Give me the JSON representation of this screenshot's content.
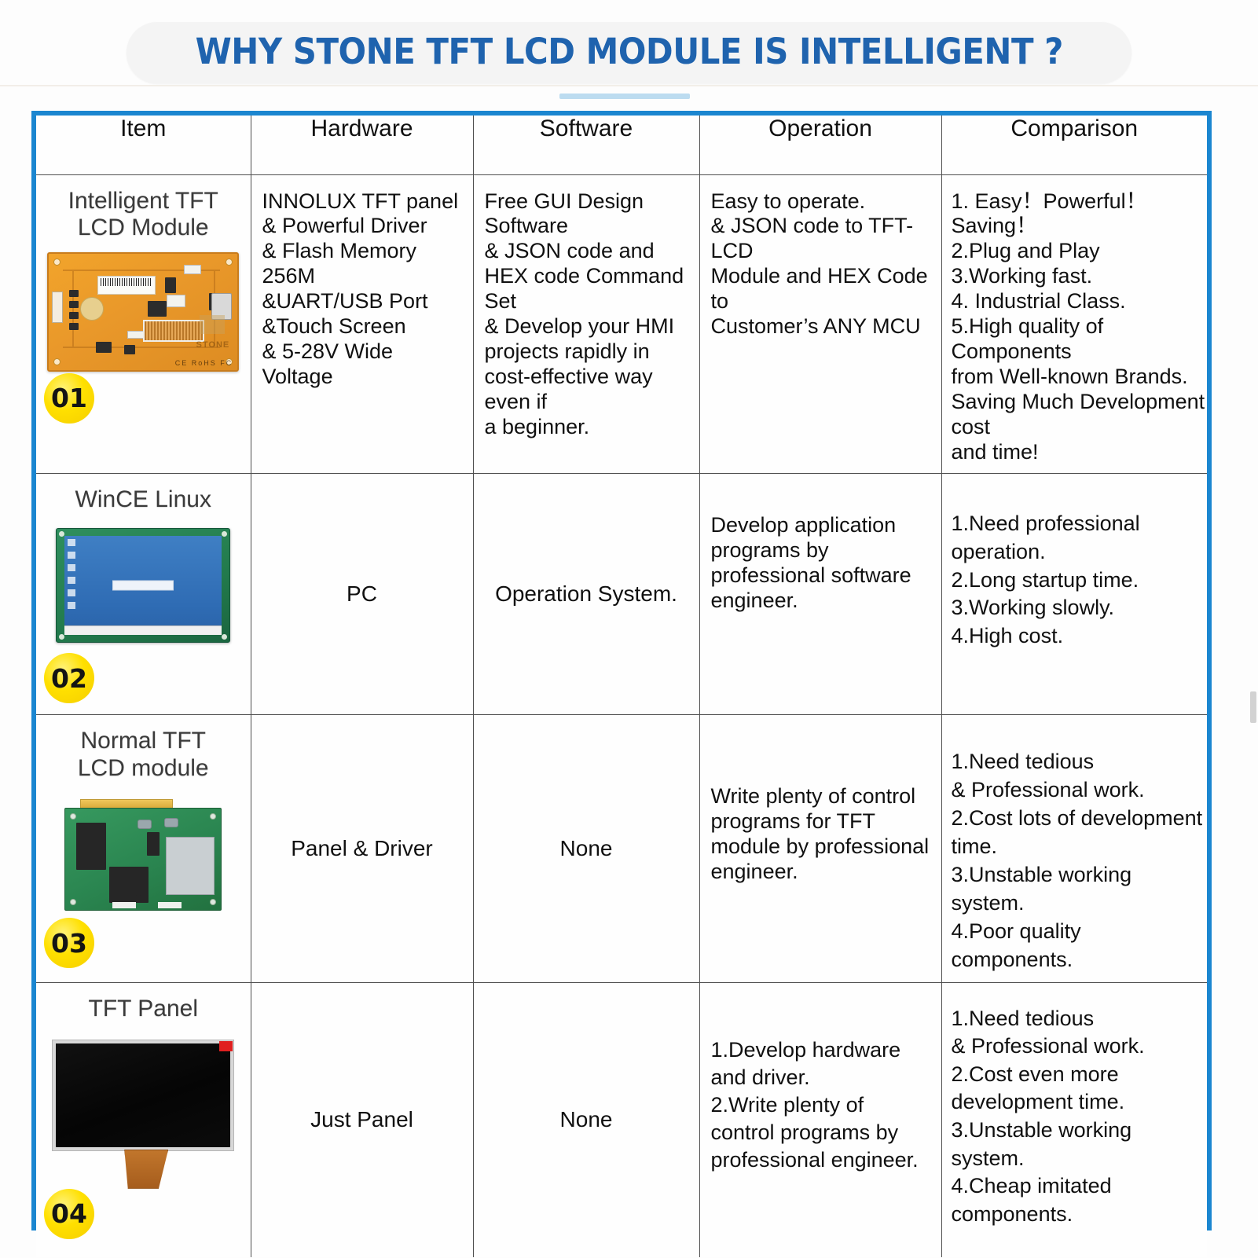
{
  "title": "WHY STONE TFT LCD MODULE IS INTELLIGENT ?",
  "colors": {
    "title_blue": "#1f63ae",
    "frame_blue": "#1b86d0",
    "accent_light_blue": "#bcdcf0",
    "badge_yellow": "#ffe000"
  },
  "table": {
    "headers": [
      "Item",
      "Hardware",
      "Software",
      "Operation",
      "Comparison"
    ],
    "rows": [
      {
        "badge": "01",
        "item_label": "Intelligent TFT\nLCD Module",
        "item_art": "orange-tft-pcb-image",
        "hardware": "INNOLUX TFT panel\n& Powerful Driver\n& Flash Memory 256M\n&UART/USB Port\n&Touch Screen\n& 5-28V Wide Voltage",
        "software": "Free GUI Design Software\n& JSON code and\nHEX code Command Set\n& Develop your HMI\nprojects rapidly in\ncost-effective way even if\na beginner.",
        "operation": "Easy to operate.\n& JSON code to TFT-LCD\nModule and HEX Code to\nCustomer’s  ANY MCU",
        "comparison": "1. Easy！Powerful！Saving！\n2.Plug and Play\n3.Working fast.\n4. Industrial Class.\n5.High quality of Components\nfrom Well-known Brands.\nSaving Much Development cost\nand time!"
      },
      {
        "badge": "02",
        "item_label": "WinCE Linux",
        "item_art": "green-board-wince-screen-image",
        "hardware": "PC",
        "software": "Operation System.",
        "operation": "Develop application\nprograms by\nprofessional software\nengineer.",
        "comparison": "1.Need professional\n   operation.\n2.Long startup time.\n3.Working slowly.\n4.High cost."
      },
      {
        "badge": "03",
        "item_label": "Normal TFT\nLCD module",
        "item_art": "green-driver-board-image",
        "hardware": "Panel & Driver",
        "software": "None",
        "operation": "Write plenty of control\nprograms for TFT\nmodule by professional\nengineer.",
        "comparison": "1.Need tedious\n   & Professional work.\n2.Cost lots of development\n   time.\n3.Unstable working system.\n4.Poor quality components."
      },
      {
        "badge": "04",
        "item_label": "TFT Panel",
        "item_art": "bare-tft-panel-image",
        "hardware": "Just Panel",
        "software": "None",
        "operation": "1.Develop hardware\n   and driver.\n2.Write plenty of\n   control programs by\n   professional engineer.",
        "comparison": "1.Need tedious\n   & Professional work.\n2.Cost even more\n   development time.\n3.Unstable working system.\n4.Cheap imitated\n   components."
      }
    ]
  }
}
